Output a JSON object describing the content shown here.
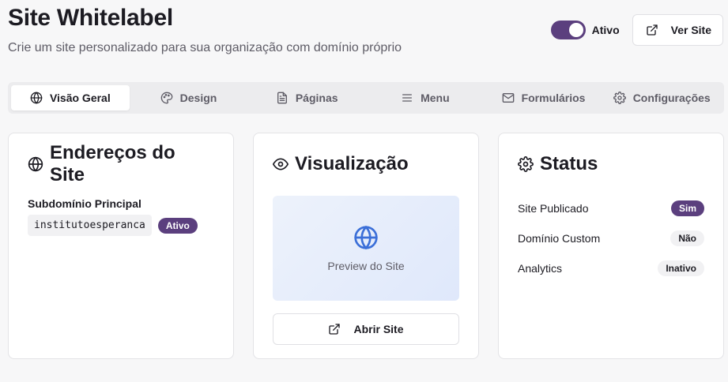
{
  "header": {
    "title": "Site Whitelabel",
    "subtitle": "Crie um site personalizado para sua organização com domínio próprio",
    "toggle_label": "Ativo",
    "view_site_label": "Ver Site"
  },
  "tabs": [
    {
      "label": "Visão Geral",
      "icon": "globe-icon",
      "active": true
    },
    {
      "label": "Design",
      "icon": "palette-icon",
      "active": false
    },
    {
      "label": "Páginas",
      "icon": "file-text-icon",
      "active": false
    },
    {
      "label": "Menu",
      "icon": "menu-icon",
      "active": false
    },
    {
      "label": "Formulários",
      "icon": "mail-icon",
      "active": false
    },
    {
      "label": "Configurações",
      "icon": "gear-icon",
      "active": false
    }
  ],
  "addresses": {
    "title": "Endereços do Site",
    "subdomain_label": "Subdomínio Principal",
    "subdomain_value": "institutoesperanca",
    "subdomain_status": "Ativo"
  },
  "preview": {
    "title": "Visualização",
    "placeholder": "Preview do Site",
    "open_label": "Abrir Site"
  },
  "status": {
    "title": "Status",
    "rows": [
      {
        "label": "Site Publicado",
        "value": "Sim",
        "on": true
      },
      {
        "label": "Domínio Custom",
        "value": "Não",
        "on": false
      },
      {
        "label": "Analytics",
        "value": "Inativo",
        "on": false
      }
    ]
  },
  "colors": {
    "accent": "#5b3f7e",
    "preview_bg": "#e4ecfb",
    "globe_blue": "#3b6fd8"
  }
}
